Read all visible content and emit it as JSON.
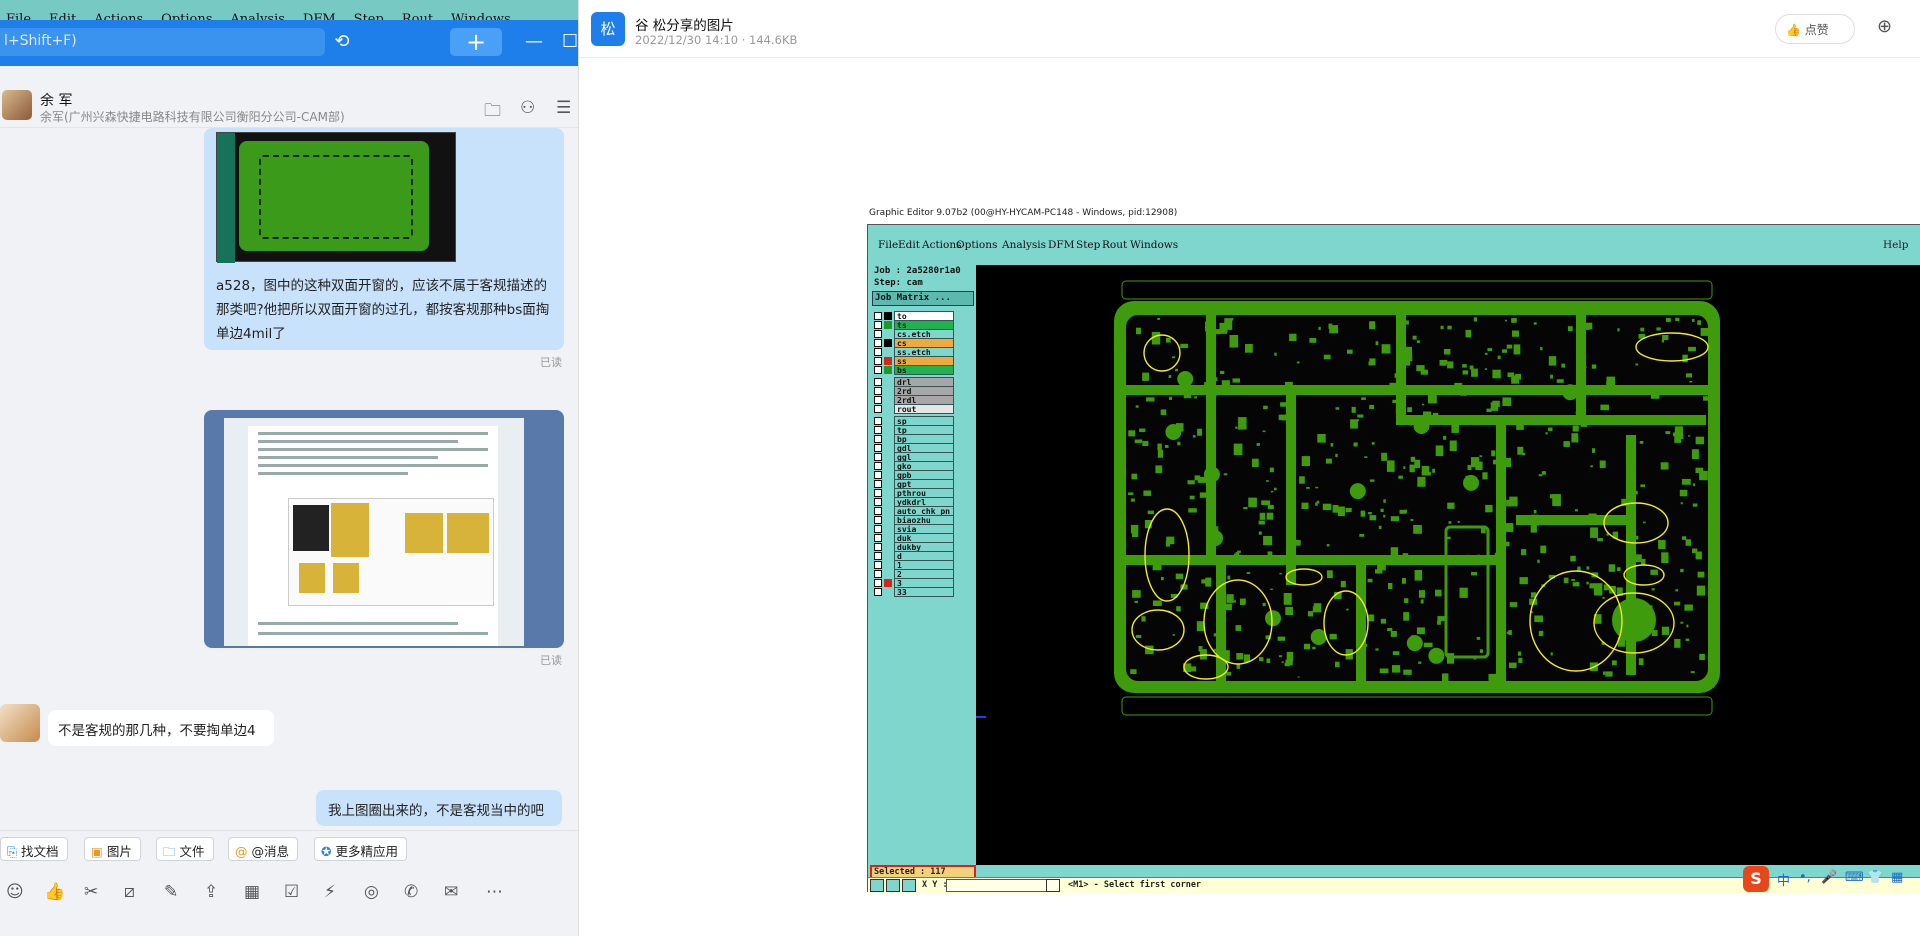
{
  "bg_app_menu": [
    "File",
    "Edit",
    "Actions",
    "Options",
    "Analysis",
    "DFM",
    "Step",
    "Rout",
    "Windows"
  ],
  "chat": {
    "search_placeholder": "l+Shift+F)",
    "history_icon": "history-icon",
    "add_label": "+",
    "minimize_label": "—",
    "maximize_label": "☐",
    "contact_name": "余 军",
    "contact_org": "余军(广州兴森快捷电路科技有限公司衡阳分公司-CAM部)",
    "messages": [
      {
        "type": "image+text",
        "text": "a528，图中的这种双面开窗的，应该不属于客规描述的那类吧?他把所以双面开窗的过孔，都按客规那种bs面掏单边4mil了",
        "status": "已读"
      },
      {
        "type": "image",
        "status": "已读"
      },
      {
        "type": "text",
        "from": "contact",
        "text": "不是客规的那几种，不要掏单边4"
      },
      {
        "type": "text",
        "from": "me",
        "text": "我上图圈出来的，不是客规当中的吧"
      }
    ],
    "actions": [
      {
        "icon": "doc-icon",
        "label": "找文档"
      },
      {
        "icon": "picture-icon",
        "label": "图片"
      },
      {
        "icon": "folder-icon",
        "label": "文件"
      },
      {
        "icon": "at-icon",
        "label": "@消息"
      },
      {
        "icon": "apps-icon",
        "label": "更多精应用"
      }
    ],
    "tool_glyphs": [
      "☺",
      "👍",
      "✂",
      "⧄",
      "✎",
      "⇪",
      "▦",
      "☑",
      "⚡",
      "◎",
      "✆",
      "✉",
      "⋯"
    ]
  },
  "viewer": {
    "logo": "松",
    "title": "谷 松分享的图片",
    "meta": "2022/12/30 14:10 · 144.6KB",
    "like_label": "点赞",
    "zoom_icon": "zoom-in-icon"
  },
  "graphic_editor": {
    "title": "Graphic Editor 9.07b2 (00@HY-HYCAM-PC148 - Windows, pid:12908)",
    "menu": [
      "File",
      "Edit",
      "Actions",
      "Options",
      "Analysis",
      "DFM",
      "Step",
      "Rout",
      "Windows"
    ],
    "help": "Help",
    "job": "Job : 2a5280r1a0",
    "step": "Step: cam",
    "job_matrix": "Job Matrix ...",
    "layers": [
      {
        "name": "to",
        "color": "#000000",
        "bg": "#ffffff"
      },
      {
        "name": "ts",
        "color": "#1a9a2a",
        "bg": "#1fb24f"
      },
      {
        "name": "cs.etch",
        "color": "#7fd6cc",
        "bg": "#7fd6cc"
      },
      {
        "name": "cs",
        "color": "#000000",
        "bg": "#f2a93b"
      },
      {
        "name": "ss.etch",
        "color": "#7fd6cc",
        "bg": "#7fd6cc"
      },
      {
        "name": "ss",
        "color": "#d8241a",
        "bg": "#f2a93b"
      },
      {
        "name": "bs",
        "color": "#1a9a2a",
        "bg": "#1fb24f"
      },
      {
        "name": "drl",
        "color": "#7fd6cc",
        "bg": "#a7a7a7"
      },
      {
        "name": "2rd",
        "color": "#7fd6cc",
        "bg": "#a7a7a7"
      },
      {
        "name": "2rdl",
        "color": "#7fd6cc",
        "bg": "#a7a7a7"
      },
      {
        "name": "rout",
        "color": "#7fd6cc",
        "bg": "#e6e6e6"
      },
      {
        "name": "sp",
        "color": "#7fd6cc",
        "bg": "#7fd6cc"
      },
      {
        "name": "tp",
        "color": "#7fd6cc",
        "bg": "#7fd6cc"
      },
      {
        "name": "bp",
        "color": "#7fd6cc",
        "bg": "#7fd6cc"
      },
      {
        "name": "gdl",
        "color": "#7fd6cc",
        "bg": "#7fd6cc"
      },
      {
        "name": "ggl",
        "color": "#7fd6cc",
        "bg": "#7fd6cc"
      },
      {
        "name": "gko",
        "color": "#7fd6cc",
        "bg": "#7fd6cc"
      },
      {
        "name": "gpb",
        "color": "#7fd6cc",
        "bg": "#7fd6cc"
      },
      {
        "name": "gpt",
        "color": "#7fd6cc",
        "bg": "#7fd6cc"
      },
      {
        "name": "pthrou",
        "color": "#7fd6cc",
        "bg": "#7fd6cc"
      },
      {
        "name": "ydkdrl",
        "color": "#7fd6cc",
        "bg": "#7fd6cc"
      },
      {
        "name": "auto_chk_pn",
        "color": "#7fd6cc",
        "bg": "#7fd6cc"
      },
      {
        "name": "biaozhu",
        "color": "#7fd6cc",
        "bg": "#7fd6cc"
      },
      {
        "name": "svia",
        "color": "#7fd6cc",
        "bg": "#7fd6cc"
      },
      {
        "name": "duk",
        "color": "#7fd6cc",
        "bg": "#7fd6cc"
      },
      {
        "name": "dukby",
        "color": "#7fd6cc",
        "bg": "#7fd6cc"
      },
      {
        "name": "d",
        "color": "#7fd6cc",
        "bg": "#7fd6cc"
      },
      {
        "name": "1",
        "color": "#7fd6cc",
        "bg": "#7fd6cc"
      },
      {
        "name": "2",
        "color": "#7fd6cc",
        "bg": "#7fd6cc"
      },
      {
        "name": "3",
        "color": "#d8241a",
        "bg": "#7fd6cc"
      },
      {
        "name": "33",
        "color": "#7fd6cc",
        "bg": "#7fd6cc"
      }
    ],
    "selected": "Selected : 117",
    "xy_label": "X Y :",
    "status": "<M1> - Select first corner"
  },
  "ime": {
    "logo": "S",
    "labels": [
      "中",
      "•,",
      "🎤",
      "⌨",
      "👕",
      "▦"
    ]
  },
  "colors": {
    "pcb_green": "#3e9b0c",
    "ge_panel": "#7fd6cc",
    "chat_blue": "#1e7fea",
    "bubble": "#c9e2fb"
  }
}
